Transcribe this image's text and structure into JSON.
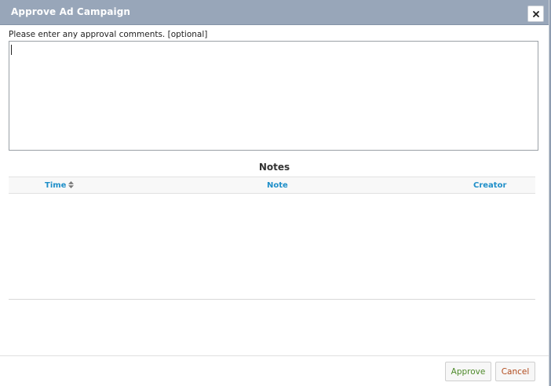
{
  "dialog": {
    "title": "Approve Ad Campaign",
    "close_icon": "close-icon"
  },
  "comments": {
    "label": "Please enter any approval comments. [optional]",
    "value": ""
  },
  "notes": {
    "title": "Notes",
    "columns": [
      "Time",
      "Note",
      "Creator"
    ],
    "sort_icon": "sort-icon",
    "rows": []
  },
  "footer": {
    "approve_label": "Approve",
    "cancel_label": "Cancel"
  },
  "colors": {
    "titlebar": "#98a6b9",
    "link_header": "#1f8fc9",
    "approve_text": "#4e8a2a",
    "cancel_text": "#b14a1c"
  }
}
